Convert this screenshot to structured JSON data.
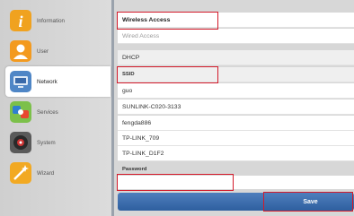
{
  "sidebar": {
    "items": [
      {
        "label": "Information",
        "icon": "info-icon"
      },
      {
        "label": "User",
        "icon": "user-icon"
      },
      {
        "label": "Network",
        "icon": "network-icon"
      },
      {
        "label": "Services",
        "icon": "services-icon"
      },
      {
        "label": "System",
        "icon": "system-icon"
      },
      {
        "label": "Wizard",
        "icon": "wizard-icon"
      }
    ]
  },
  "tabs": {
    "wireless": "Wireless Access",
    "wired": "Wired Access"
  },
  "mode": "DHCP",
  "ssid_section": "SSID",
  "networks": [
    "guo",
    "SUNLINK-C020-3133",
    "fengda886",
    "TP-LINK_709",
    "TP-LINK_D1F2"
  ],
  "password": {
    "label": "Password",
    "value": ""
  },
  "save_label": "Save",
  "colors": {
    "highlight": "#d31a2a",
    "save_bar": "#3a6aaa",
    "divider": "#9aa2ac"
  }
}
